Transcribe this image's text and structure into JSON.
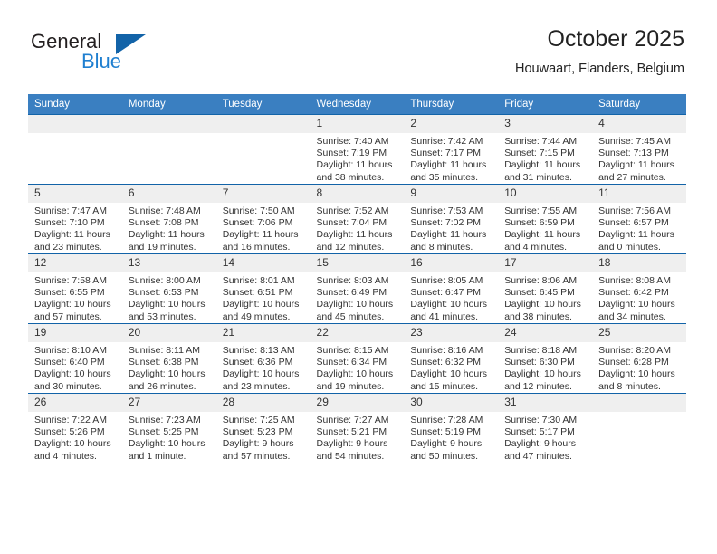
{
  "brand": {
    "name_part1": "General",
    "name_part2": "Blue",
    "triangle_color": "#1263a8",
    "blue_color": "#1f7fd0"
  },
  "header": {
    "title": "October 2025",
    "subtitle": "Houwaart, Flanders, Belgium"
  },
  "theme": {
    "header_bg": "#3a7fc1",
    "cell_border": "#1263a8",
    "daynum_bg": "#efefef"
  },
  "weekdays": [
    "Sunday",
    "Monday",
    "Tuesday",
    "Wednesday",
    "Thursday",
    "Friday",
    "Saturday"
  ],
  "weeks": [
    [
      {
        "day": "",
        "empty": true
      },
      {
        "day": "",
        "empty": true
      },
      {
        "day": "",
        "empty": true
      },
      {
        "day": "1",
        "sunrise": "Sunrise: 7:40 AM",
        "sunset": "Sunset: 7:19 PM",
        "daylight1": "Daylight: 11 hours",
        "daylight2": "and 38 minutes."
      },
      {
        "day": "2",
        "sunrise": "Sunrise: 7:42 AM",
        "sunset": "Sunset: 7:17 PM",
        "daylight1": "Daylight: 11 hours",
        "daylight2": "and 35 minutes."
      },
      {
        "day": "3",
        "sunrise": "Sunrise: 7:44 AM",
        "sunset": "Sunset: 7:15 PM",
        "daylight1": "Daylight: 11 hours",
        "daylight2": "and 31 minutes."
      },
      {
        "day": "4",
        "sunrise": "Sunrise: 7:45 AM",
        "sunset": "Sunset: 7:13 PM",
        "daylight1": "Daylight: 11 hours",
        "daylight2": "and 27 minutes."
      }
    ],
    [
      {
        "day": "5",
        "sunrise": "Sunrise: 7:47 AM",
        "sunset": "Sunset: 7:10 PM",
        "daylight1": "Daylight: 11 hours",
        "daylight2": "and 23 minutes."
      },
      {
        "day": "6",
        "sunrise": "Sunrise: 7:48 AM",
        "sunset": "Sunset: 7:08 PM",
        "daylight1": "Daylight: 11 hours",
        "daylight2": "and 19 minutes."
      },
      {
        "day": "7",
        "sunrise": "Sunrise: 7:50 AM",
        "sunset": "Sunset: 7:06 PM",
        "daylight1": "Daylight: 11 hours",
        "daylight2": "and 16 minutes."
      },
      {
        "day": "8",
        "sunrise": "Sunrise: 7:52 AM",
        "sunset": "Sunset: 7:04 PM",
        "daylight1": "Daylight: 11 hours",
        "daylight2": "and 12 minutes."
      },
      {
        "day": "9",
        "sunrise": "Sunrise: 7:53 AM",
        "sunset": "Sunset: 7:02 PM",
        "daylight1": "Daylight: 11 hours",
        "daylight2": "and 8 minutes."
      },
      {
        "day": "10",
        "sunrise": "Sunrise: 7:55 AM",
        "sunset": "Sunset: 6:59 PM",
        "daylight1": "Daylight: 11 hours",
        "daylight2": "and 4 minutes."
      },
      {
        "day": "11",
        "sunrise": "Sunrise: 7:56 AM",
        "sunset": "Sunset: 6:57 PM",
        "daylight1": "Daylight: 11 hours",
        "daylight2": "and 0 minutes."
      }
    ],
    [
      {
        "day": "12",
        "sunrise": "Sunrise: 7:58 AM",
        "sunset": "Sunset: 6:55 PM",
        "daylight1": "Daylight: 10 hours",
        "daylight2": "and 57 minutes."
      },
      {
        "day": "13",
        "sunrise": "Sunrise: 8:00 AM",
        "sunset": "Sunset: 6:53 PM",
        "daylight1": "Daylight: 10 hours",
        "daylight2": "and 53 minutes."
      },
      {
        "day": "14",
        "sunrise": "Sunrise: 8:01 AM",
        "sunset": "Sunset: 6:51 PM",
        "daylight1": "Daylight: 10 hours",
        "daylight2": "and 49 minutes."
      },
      {
        "day": "15",
        "sunrise": "Sunrise: 8:03 AM",
        "sunset": "Sunset: 6:49 PM",
        "daylight1": "Daylight: 10 hours",
        "daylight2": "and 45 minutes."
      },
      {
        "day": "16",
        "sunrise": "Sunrise: 8:05 AM",
        "sunset": "Sunset: 6:47 PM",
        "daylight1": "Daylight: 10 hours",
        "daylight2": "and 41 minutes."
      },
      {
        "day": "17",
        "sunrise": "Sunrise: 8:06 AM",
        "sunset": "Sunset: 6:45 PM",
        "daylight1": "Daylight: 10 hours",
        "daylight2": "and 38 minutes."
      },
      {
        "day": "18",
        "sunrise": "Sunrise: 8:08 AM",
        "sunset": "Sunset: 6:42 PM",
        "daylight1": "Daylight: 10 hours",
        "daylight2": "and 34 minutes."
      }
    ],
    [
      {
        "day": "19",
        "sunrise": "Sunrise: 8:10 AM",
        "sunset": "Sunset: 6:40 PM",
        "daylight1": "Daylight: 10 hours",
        "daylight2": "and 30 minutes."
      },
      {
        "day": "20",
        "sunrise": "Sunrise: 8:11 AM",
        "sunset": "Sunset: 6:38 PM",
        "daylight1": "Daylight: 10 hours",
        "daylight2": "and 26 minutes."
      },
      {
        "day": "21",
        "sunrise": "Sunrise: 8:13 AM",
        "sunset": "Sunset: 6:36 PM",
        "daylight1": "Daylight: 10 hours",
        "daylight2": "and 23 minutes."
      },
      {
        "day": "22",
        "sunrise": "Sunrise: 8:15 AM",
        "sunset": "Sunset: 6:34 PM",
        "daylight1": "Daylight: 10 hours",
        "daylight2": "and 19 minutes."
      },
      {
        "day": "23",
        "sunrise": "Sunrise: 8:16 AM",
        "sunset": "Sunset: 6:32 PM",
        "daylight1": "Daylight: 10 hours",
        "daylight2": "and 15 minutes."
      },
      {
        "day": "24",
        "sunrise": "Sunrise: 8:18 AM",
        "sunset": "Sunset: 6:30 PM",
        "daylight1": "Daylight: 10 hours",
        "daylight2": "and 12 minutes."
      },
      {
        "day": "25",
        "sunrise": "Sunrise: 8:20 AM",
        "sunset": "Sunset: 6:28 PM",
        "daylight1": "Daylight: 10 hours",
        "daylight2": "and 8 minutes."
      }
    ],
    [
      {
        "day": "26",
        "sunrise": "Sunrise: 7:22 AM",
        "sunset": "Sunset: 5:26 PM",
        "daylight1": "Daylight: 10 hours",
        "daylight2": "and 4 minutes."
      },
      {
        "day": "27",
        "sunrise": "Sunrise: 7:23 AM",
        "sunset": "Sunset: 5:25 PM",
        "daylight1": "Daylight: 10 hours",
        "daylight2": "and 1 minute."
      },
      {
        "day": "28",
        "sunrise": "Sunrise: 7:25 AM",
        "sunset": "Sunset: 5:23 PM",
        "daylight1": "Daylight: 9 hours",
        "daylight2": "and 57 minutes."
      },
      {
        "day": "29",
        "sunrise": "Sunrise: 7:27 AM",
        "sunset": "Sunset: 5:21 PM",
        "daylight1": "Daylight: 9 hours",
        "daylight2": "and 54 minutes."
      },
      {
        "day": "30",
        "sunrise": "Sunrise: 7:28 AM",
        "sunset": "Sunset: 5:19 PM",
        "daylight1": "Daylight: 9 hours",
        "daylight2": "and 50 minutes."
      },
      {
        "day": "31",
        "sunrise": "Sunrise: 7:30 AM",
        "sunset": "Sunset: 5:17 PM",
        "daylight1": "Daylight: 9 hours",
        "daylight2": "and 47 minutes."
      },
      {
        "day": "",
        "empty": true
      }
    ]
  ]
}
